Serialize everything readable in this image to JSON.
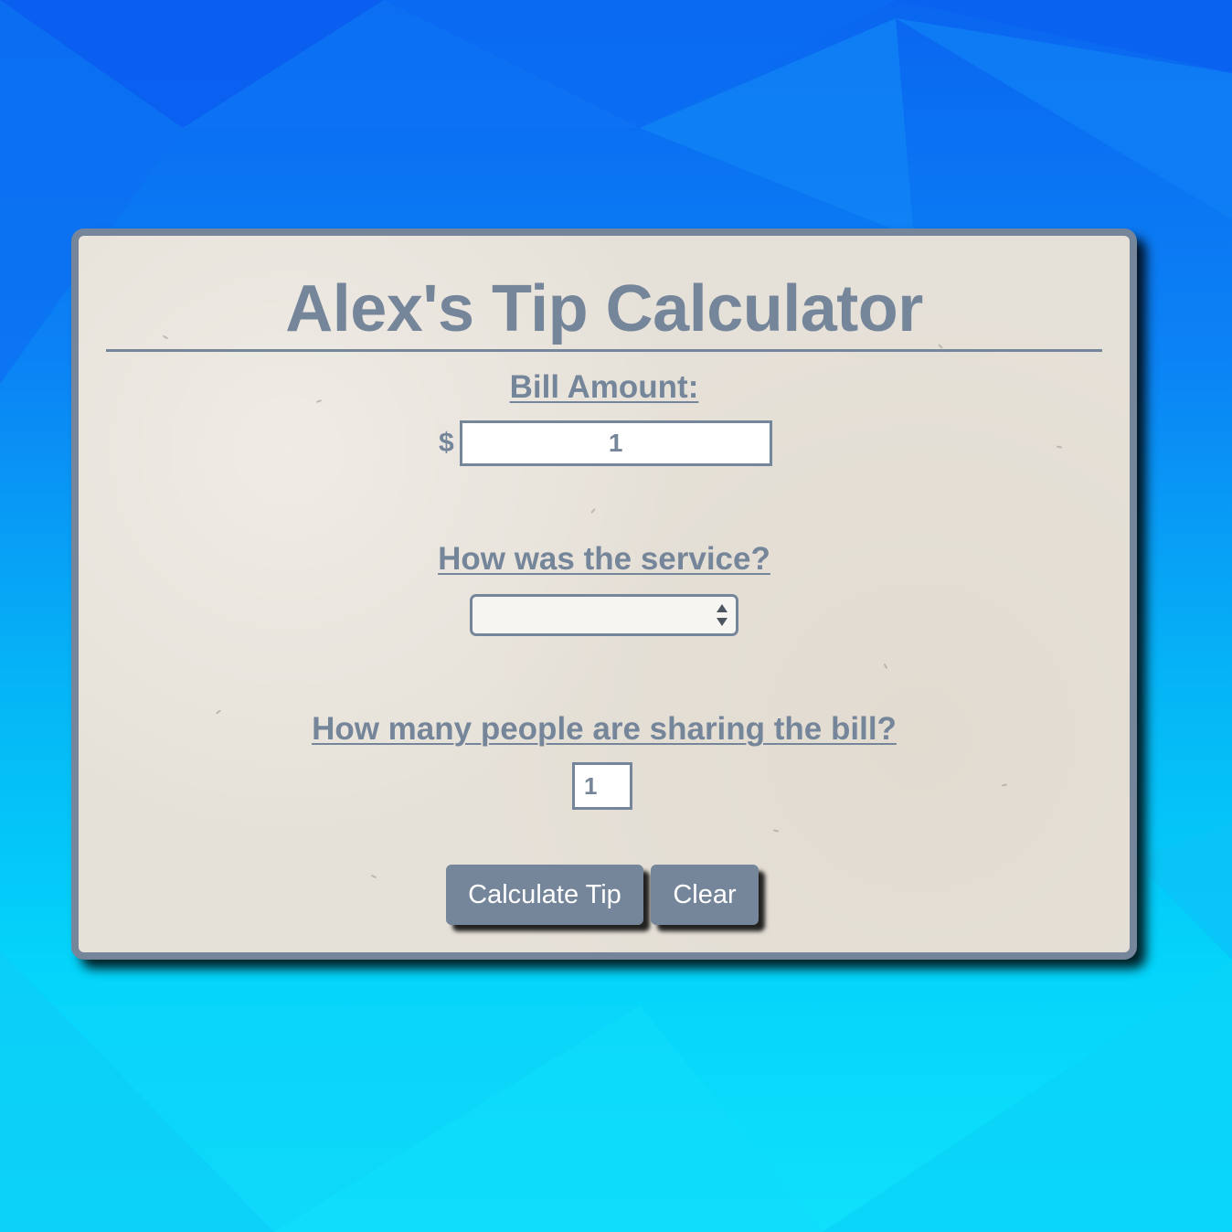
{
  "app": {
    "title": "Alex's Tip Calculator"
  },
  "bill": {
    "label": "Bill Amount:",
    "currency_symbol": "$",
    "value": "1"
  },
  "service": {
    "label": "How was the service?",
    "selected": ""
  },
  "people": {
    "label": "How many people are sharing the bill?",
    "value": "1"
  },
  "buttons": {
    "calculate_label": "Calculate Tip",
    "clear_label": "Clear"
  },
  "colors": {
    "accent": "#76869a",
    "card_bg": "#e6e1d8",
    "bg_top": "#0a66f0",
    "bg_bottom": "#0fe0fb"
  },
  "icons": {
    "select_arrow": "chevron-up-down-icon"
  }
}
